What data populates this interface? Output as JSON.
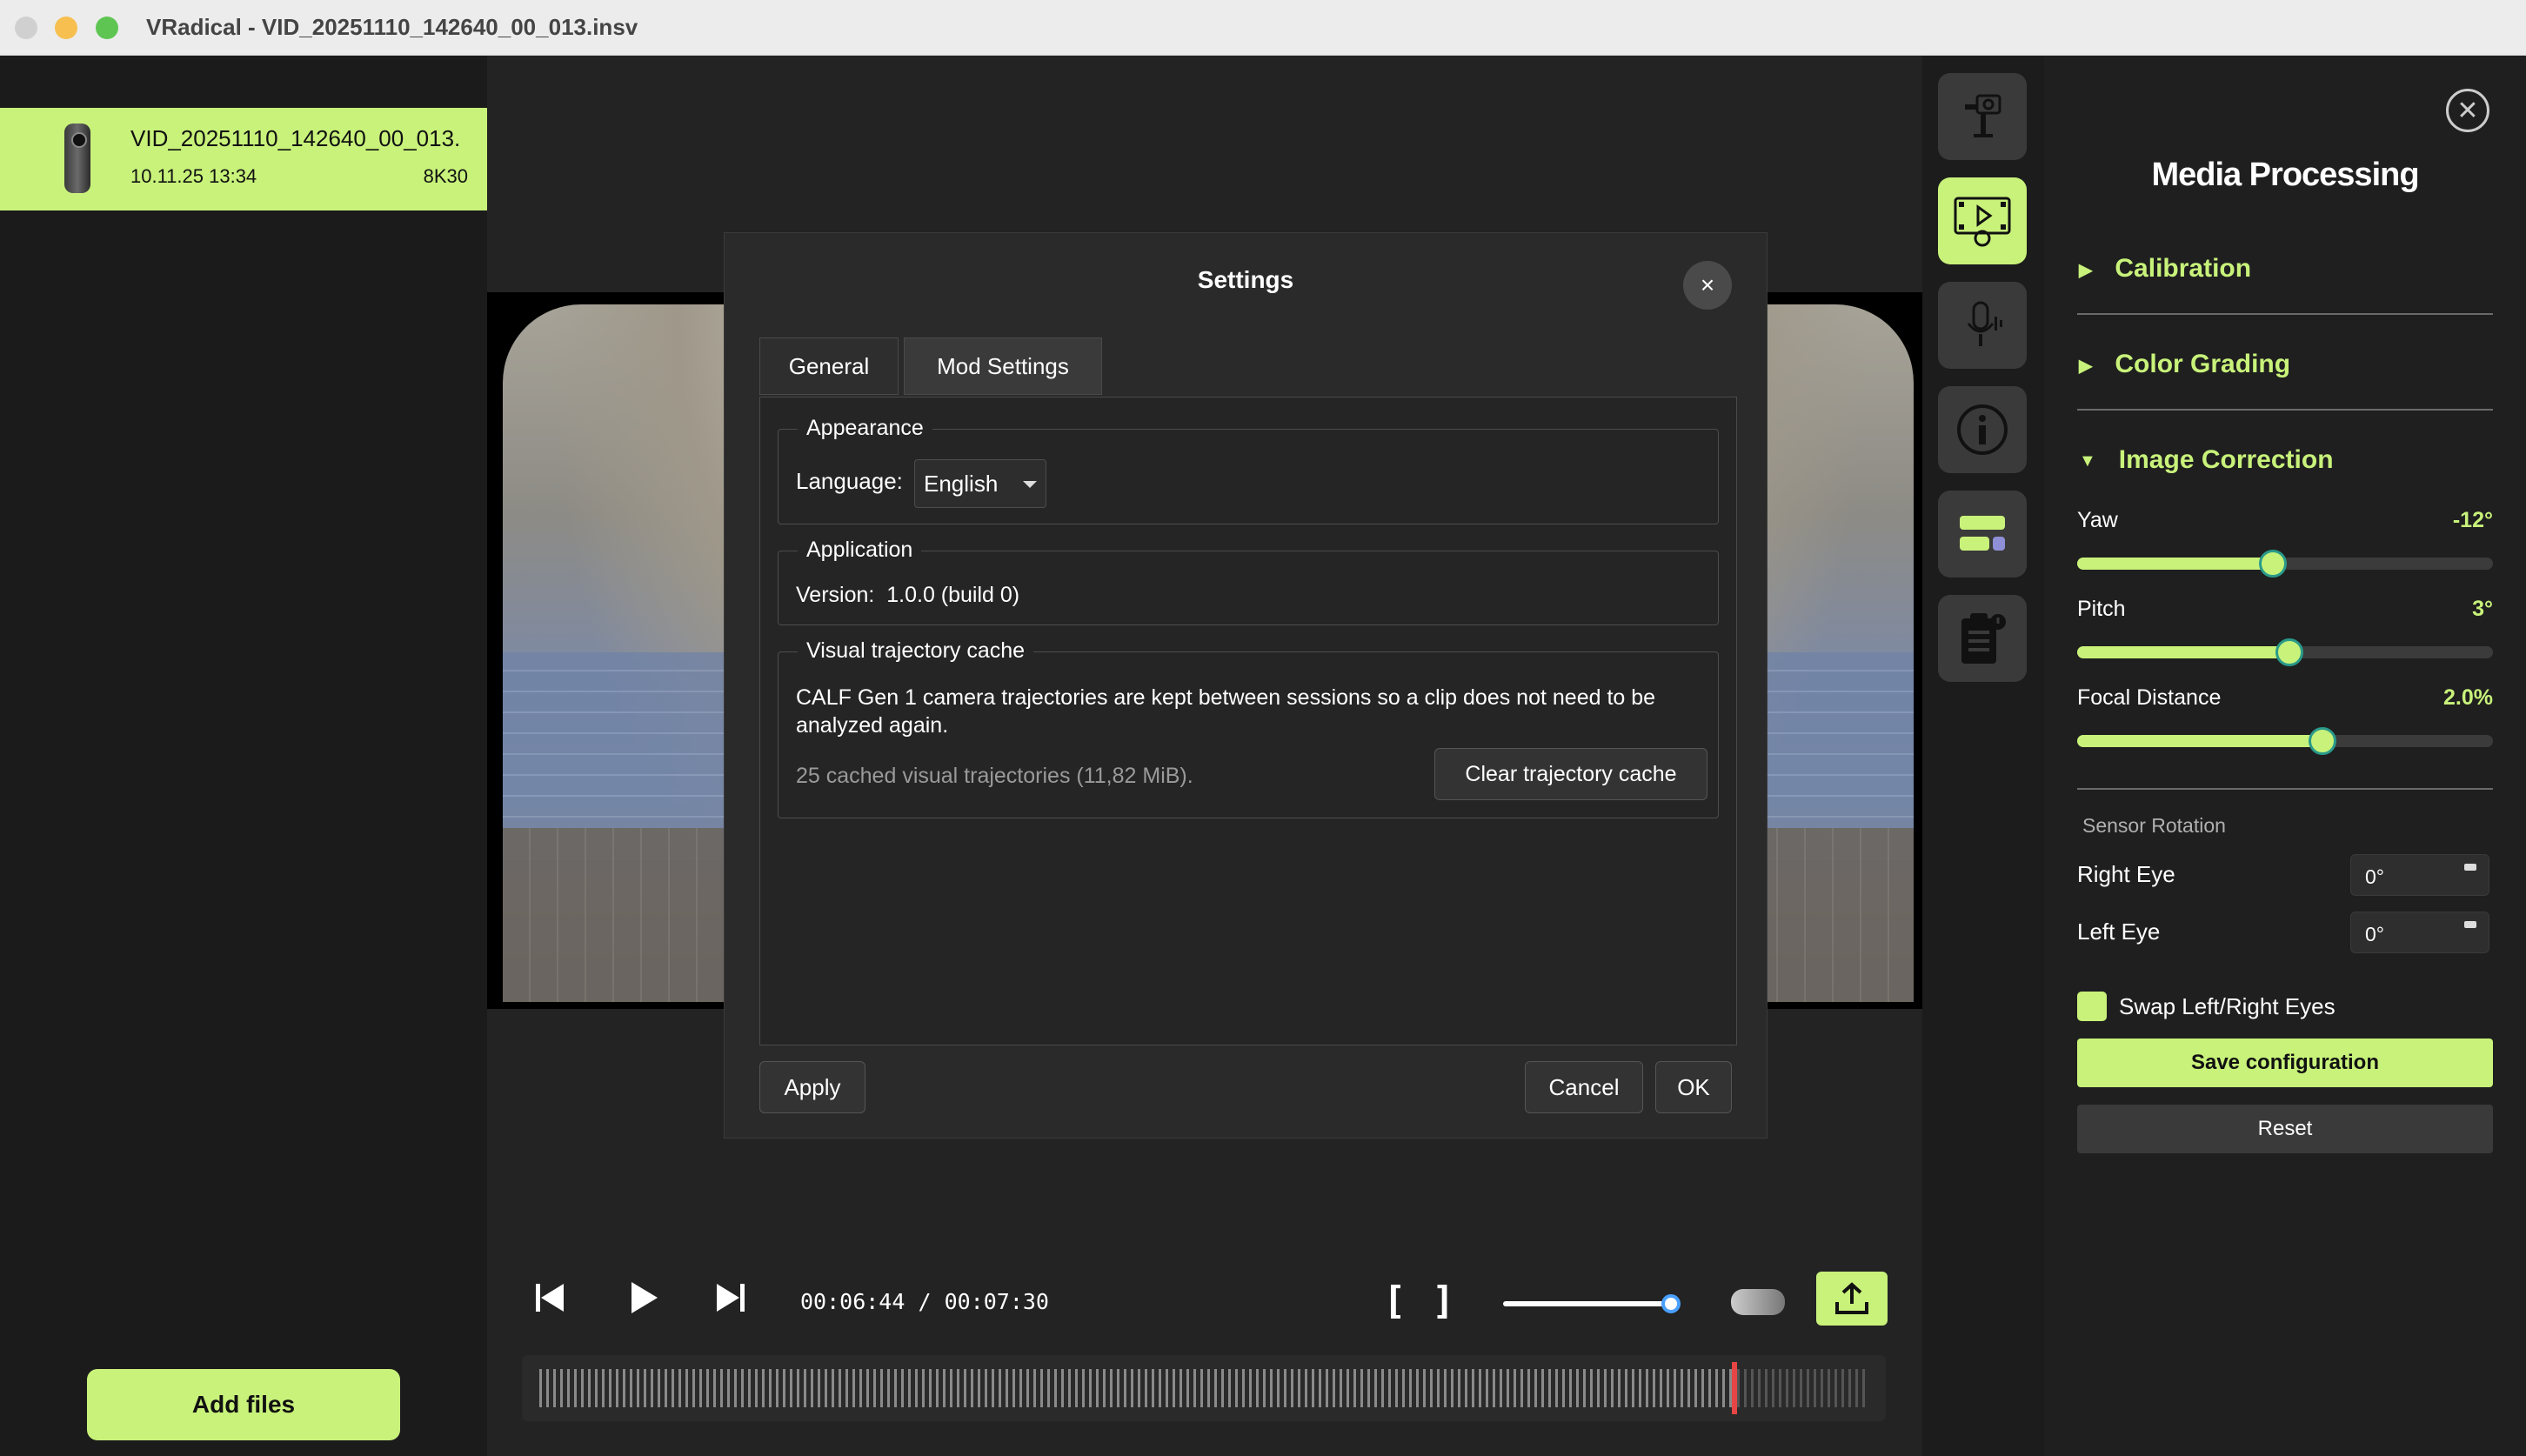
{
  "window": {
    "title": "VRadical - VID_20251110_142640_00_013.insv"
  },
  "files": [
    {
      "name": "VID_20251110_142640_00_013.",
      "date": "10.11.25 13:34",
      "resolution": "8K30"
    }
  ],
  "left_panel": {
    "add_files_label": "Add files"
  },
  "dialog": {
    "title": "Settings",
    "close_glyph": "×",
    "tabs": [
      {
        "label": "General"
      },
      {
        "label": "Mod Settings"
      }
    ],
    "appearance": {
      "legend": "Appearance",
      "language_label": "Language:",
      "language_value": "English"
    },
    "application": {
      "legend": "Application",
      "version_label": "Version:",
      "version_value": "1.0.0 (build 0)"
    },
    "cache": {
      "legend": "Visual trajectory cache",
      "description": "CALF Gen 1 camera trajectories are kept between sessions so a clip does not need to be analyzed again.",
      "count_text": "25 cached visual trajectories (11,82 MiB).",
      "clear_label": "Clear trajectory cache"
    },
    "buttons": {
      "apply": "Apply",
      "cancel": "Cancel",
      "ok": "OK"
    }
  },
  "player": {
    "time_text": "00:06:44 / 00:07:30",
    "in_mark": "[",
    "out_mark": "]",
    "volume": 1.0,
    "playhead_fraction": 0.897
  },
  "side_icons": [
    "camera-rig-icon",
    "media-processing-icon",
    "audio-icon",
    "info-icon",
    "layout-icon",
    "clipboard-icon"
  ],
  "right_panel": {
    "close_glyph": "✕",
    "title": "Media Processing",
    "sections": {
      "calibration": "Calibration",
      "color_grading": "Color Grading",
      "image_correction": "Image Correction"
    },
    "sliders": {
      "yaw": {
        "label": "Yaw",
        "value": "-12°",
        "fraction": 0.47
      },
      "pitch": {
        "label": "Pitch",
        "value": "3°",
        "fraction": 0.51
      },
      "focal": {
        "label": "Focal Distance",
        "value": "2.0%",
        "fraction": 0.59
      }
    },
    "sensor_rotation": {
      "title": "Sensor Rotation",
      "right_label": "Right Eye",
      "right_value": "0°",
      "left_label": "Left Eye",
      "left_value": "0°"
    },
    "swap_label": "Swap Left/Right Eyes",
    "save_label": "Save configuration",
    "reset_label": "Reset"
  },
  "colors": {
    "accent": "#c8f27a",
    "playhead": "#e64545",
    "background": "#1c1c1c"
  }
}
